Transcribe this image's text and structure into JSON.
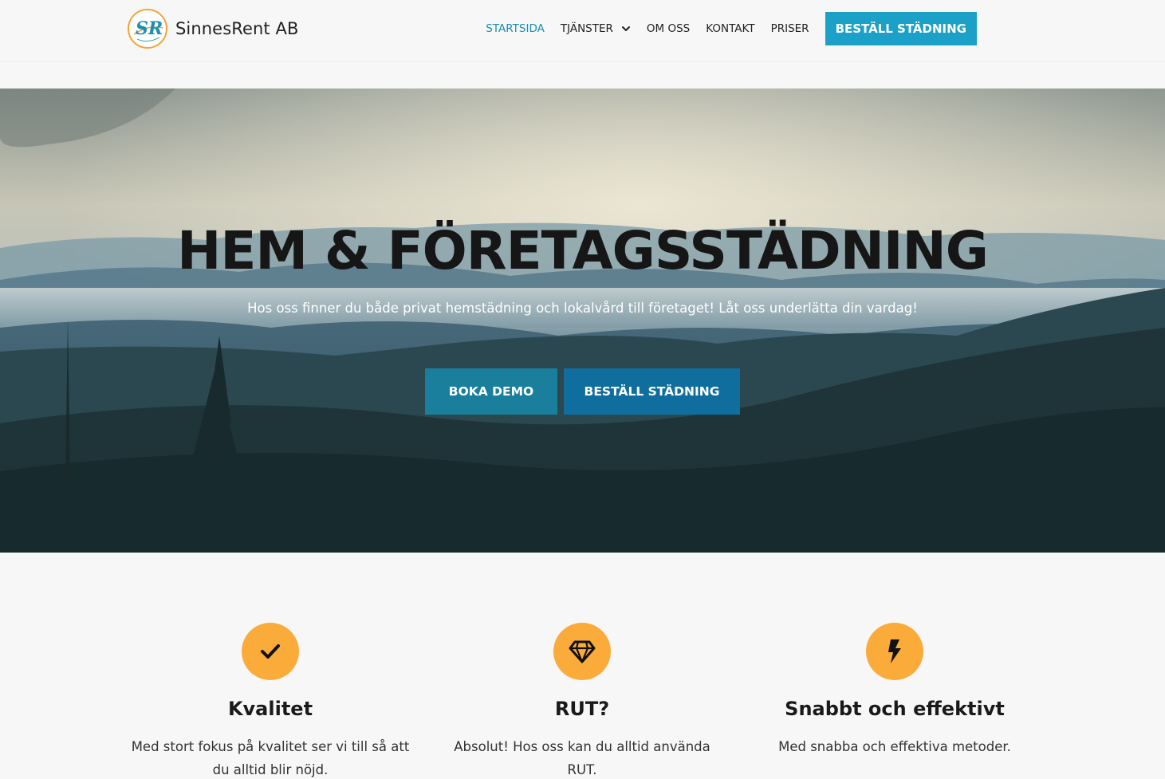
{
  "brand": {
    "name": "SinnesRent AB",
    "logo_letters": "SR",
    "logo_ring_color": "#f4a338",
    "logo_letter_color": "#1b8eb5"
  },
  "nav": {
    "items": [
      {
        "label": "STARTSIDA",
        "active": true
      },
      {
        "label": "TJÄNSTER",
        "has_dropdown": true
      },
      {
        "label": "OM OSS"
      },
      {
        "label": "KONTAKT"
      },
      {
        "label": "PRISER"
      }
    ],
    "cta_label": "BESTÄLL STÄDNING",
    "active_color": "#1b8eb5",
    "cta_color": "#1ba1c8"
  },
  "hero": {
    "title": "HEM & FÖRETAGSSTÄDNING",
    "subtitle": "Hos oss finner du både privat hemstädning och lokalvård till företaget! Låt oss underlätta din vardag!",
    "buttons": [
      {
        "label": "BOKA DEMO",
        "color": "#1a7f9c"
      },
      {
        "label": "BESTÄLL STÄDNING",
        "color": "#0f6e9e"
      }
    ],
    "background": "misty forest mountains"
  },
  "features": [
    {
      "icon": "check-icon",
      "title": "Kvalitet",
      "text": "Med stort fokus på kvalitet ser vi till så att du alltid blir nöjd."
    },
    {
      "icon": "diamond-icon",
      "title": "RUT?",
      "text": "Absolut! Hos oss kan du alltid använda RUT."
    },
    {
      "icon": "lightning-icon",
      "title": "Snabbt och effektivt",
      "text": "Med snabba och effektiva metoder."
    }
  ],
  "colors": {
    "feature_icon_bg": "#fbab3a",
    "page_bg": "#f7f7f7"
  }
}
